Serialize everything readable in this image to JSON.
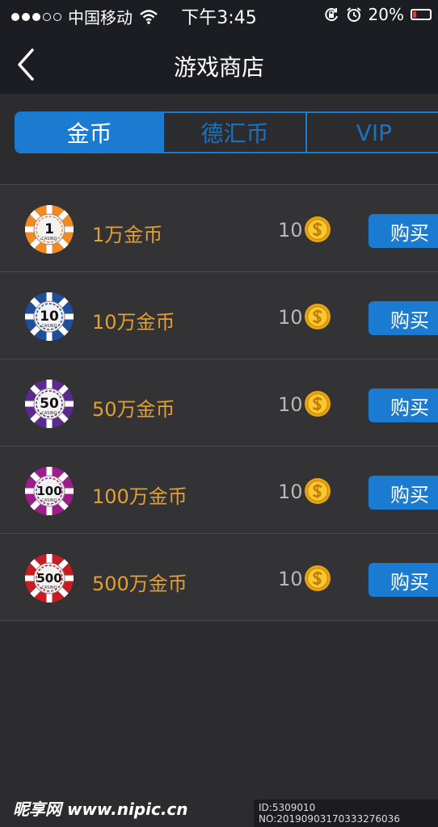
{
  "status_bar": {
    "carrier": "中国移动",
    "time": "下午3:45",
    "battery_percent": "20%",
    "battery_level": 0.2,
    "signal_bars": 3,
    "battery_color": "#e53935"
  },
  "header": {
    "title": "游戏商店",
    "back_icon": "chevron-left-icon"
  },
  "tabs": [
    {
      "label": "金币",
      "active": true
    },
    {
      "label": "德汇币",
      "active": false
    },
    {
      "label": "VIP",
      "active": false
    }
  ],
  "colors": {
    "accent": "#1a7bd0",
    "label": "#e3a030",
    "background": "#2c2c2e"
  },
  "items": [
    {
      "chip_value": "1",
      "chip_caption": "CASINO",
      "chip_color": "#f08a24",
      "label": "1万金币",
      "price": "10",
      "buy_label": "购买"
    },
    {
      "chip_value": "10",
      "chip_caption": "CASINO",
      "chip_color": "#1f4f9a",
      "label": "10万金币",
      "price": "10",
      "buy_label": "购买"
    },
    {
      "chip_value": "50",
      "chip_caption": "CASINO",
      "chip_color": "#5a2a8c",
      "label": "50万金币",
      "price": "10",
      "buy_label": "购买"
    },
    {
      "chip_value": "100",
      "chip_caption": "CASINO",
      "chip_color": "#9c1e8a",
      "label": "100万金币",
      "price": "10",
      "buy_label": "购买"
    },
    {
      "chip_value": "500",
      "chip_caption": "CASINO",
      "chip_color": "#c41e24",
      "label": "500万金币",
      "price": "10",
      "buy_label": "购买"
    }
  ],
  "watermark": {
    "logo": "昵享网 www.nipic.cn",
    "id": "ID:5309010 NO:20190903170333276036"
  }
}
